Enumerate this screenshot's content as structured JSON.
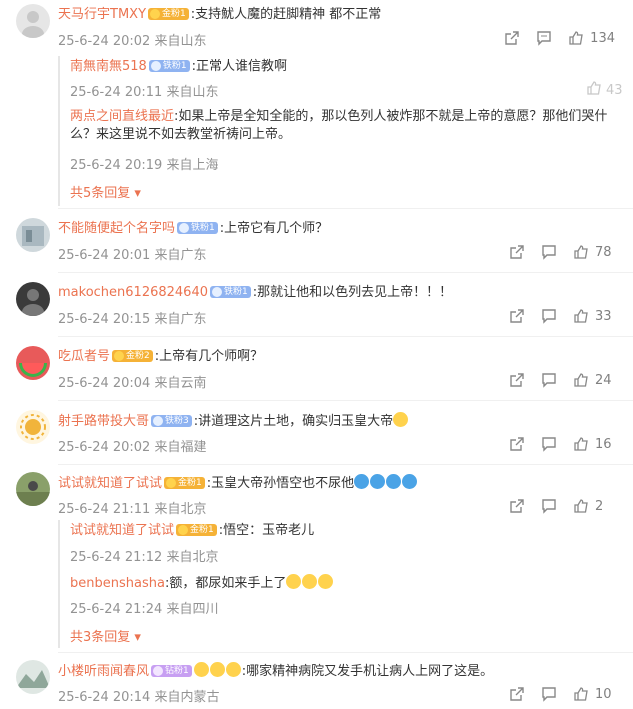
{
  "comments": [
    {
      "user": "天马行宇TMXY",
      "badge": "金粉1",
      "text": ":支持魷人魔的赶脚精神 都不正常",
      "time": "25-6-24 20:02",
      "loc": "来自山东",
      "likes": "134",
      "replies": [
        {
          "user": "南無南無518",
          "badge": "铁粉1",
          "text": ":正常人谁信教啊",
          "time": "25-6-24 20:11",
          "loc": "来自山东",
          "likes": "43"
        },
        {
          "user": "两点之间直线最近",
          "badge": "",
          "text": ":如果上帝是全知全能的，那以色列人被炸那不就是上帝的意愿？那他们哭什么？来这里说不如去教堂祈祷问上帝。",
          "time": "25-6-24 20:19",
          "loc": "来自上海",
          "likes": ""
        }
      ],
      "more": "共5条回复"
    },
    {
      "user": "不能随便起个名字吗",
      "badge": "铁粉1",
      "text": ":上帝它有几个师？",
      "time": "25-6-24 20:01",
      "loc": "来自广东",
      "likes": "78"
    },
    {
      "user": "makochen6126824640",
      "badge": "铁粉1",
      "text": ":那就让他和以色列去见上帝！！！",
      "time": "25-6-24 20:15",
      "loc": "来自广东",
      "likes": "33"
    },
    {
      "user": "吃瓜者号",
      "badge": "金粉2",
      "text": ":上帝有几个师啊？",
      "time": "25-6-24 20:04",
      "loc": "来自云南",
      "likes": "24"
    },
    {
      "user": "射手路带投大哥",
      "badge": "铁粉3",
      "text": ":讲道理这片土地，确实归玉皇大帝",
      "time": "25-6-24 20:02",
      "loc": "来自福建",
      "likes": "16"
    },
    {
      "user": "试试就知道了试试",
      "badge": "金粉1",
      "text": ":玉皇大帝孙悟空也不尿他",
      "time": "25-6-24 21:11",
      "loc": "来自北京",
      "likes": "2",
      "replies": [
        {
          "user": "试试就知道了试试",
          "badge": "金粉1",
          "text": ":悟空：玉帝老儿",
          "time": "25-6-24 21:12",
          "loc": "来自北京",
          "likes": ""
        },
        {
          "user": "benbenshasha",
          "badge": "",
          "text": ":额，都尿如来手上了",
          "time": "25-6-24 21:24",
          "loc": "来自四川",
          "likes": ""
        }
      ],
      "more": "共3条回复"
    },
    {
      "user": "小楼听雨闻春风",
      "badge": "钻粉1",
      "text": ":哪家精神病院又发手机让病人上网了这是。",
      "time": "25-6-24 20:14",
      "loc": "来自内蒙古",
      "likes": "10"
    }
  ],
  "icons": {
    "share": "share-icon",
    "comment": "comment-icon",
    "like": "thumbs-up-icon",
    "more_arrow": "caret-down-icon"
  },
  "colors": {
    "username": "#eb7350",
    "meta": "#939393"
  }
}
